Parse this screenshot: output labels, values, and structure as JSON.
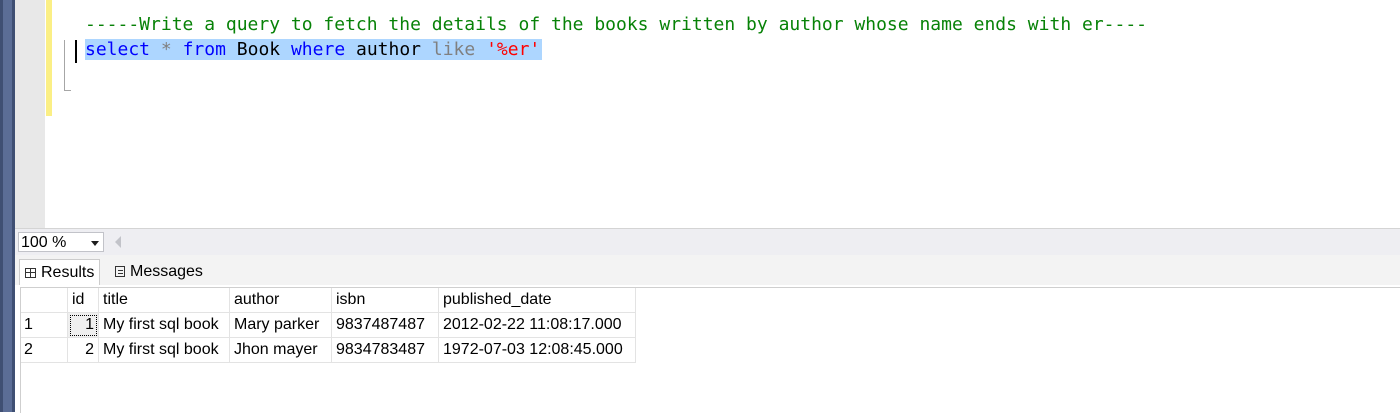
{
  "editor": {
    "comment": "-----Write a query to fetch the details of the books written by author whose name ends with er----",
    "query_tokens": {
      "select": "select",
      "star": "*",
      "from": "from",
      "table": "Book",
      "where": "where",
      "column": "author",
      "like": "like",
      "pattern": "'%er'"
    }
  },
  "toolbar": {
    "zoom_value": "100 %"
  },
  "tabs": {
    "results_label": "Results",
    "messages_label": "Messages"
  },
  "results": {
    "columns": [
      "id",
      "title",
      "author",
      "isbn",
      "published_date"
    ],
    "rows": [
      {
        "rownum": "1",
        "id": "1",
        "title": "My first sql book",
        "author": "Mary parker",
        "isbn": "9837487487",
        "published_date": "2012-02-22 11:08:17.000"
      },
      {
        "rownum": "2",
        "id": "2",
        "title": "My first sql book",
        "author": "Jhon mayer",
        "isbn": "9834783487",
        "published_date": "1972-07-03 12:08:45.000"
      }
    ]
  },
  "colors": {
    "comment": "#078207",
    "keyword": "#0000ff",
    "string": "#ff0000",
    "operator": "#808080",
    "selection": "#add6ff"
  }
}
